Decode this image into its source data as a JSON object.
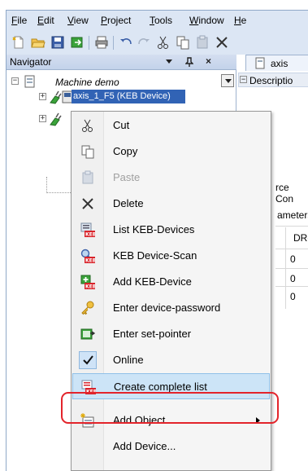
{
  "menubar": {
    "items": [
      {
        "label": "File",
        "mnemonic": "F",
        "rest": "ile"
      },
      {
        "label": "Edit",
        "mnemonic": "E",
        "rest": "dit"
      },
      {
        "label": "View",
        "mnemonic": "V",
        "rest": "iew"
      },
      {
        "label": "Project",
        "mnemonic": "P",
        "rest": "roject"
      },
      {
        "label": "Tools",
        "mnemonic": "T",
        "rest": "ools"
      },
      {
        "label": "Window",
        "mnemonic": "W",
        "rest": "indow"
      },
      {
        "label": "He",
        "mnemonic": "H",
        "rest": "e"
      }
    ]
  },
  "toolbar": {
    "icons": [
      "new-file-icon",
      "open-folder-icon",
      "save-icon",
      "export-icon",
      "print-icon",
      "undo-icon",
      "redo-icon",
      "cut-icon",
      "copy-icon",
      "paste-icon",
      "delete-icon"
    ]
  },
  "navigator": {
    "title": "Navigator",
    "pin_glyph": "▾ ⊥",
    "close_glyph": "×",
    "root_label": "Machine demo",
    "selected_child_label": "axis_1_F5 (KEB Device)"
  },
  "editor": {
    "tab_label": "axis",
    "description_label": "Descriptio",
    "fragments": {
      "source": "rce Con",
      "parameters": "ameters",
      "column": "DRe",
      "values": [
        "0",
        "0",
        "0"
      ]
    }
  },
  "context_menu": {
    "items": [
      {
        "label": "Cut",
        "icon": "cut-icon",
        "disabled": false
      },
      {
        "label": "Copy",
        "icon": "copy-icon",
        "disabled": false
      },
      {
        "label": "Paste",
        "icon": "paste-icon",
        "disabled": true
      },
      {
        "label": "Delete",
        "icon": "delete-icon",
        "disabled": false
      },
      {
        "label": "List KEB-Devices",
        "icon": "keb-list-icon",
        "disabled": false
      },
      {
        "label": "KEB Device-Scan",
        "icon": "keb-scan-icon",
        "disabled": false
      },
      {
        "label": "Add KEB-Device",
        "icon": "keb-add-icon",
        "disabled": false
      },
      {
        "label": "Enter device-password",
        "icon": "key-icon",
        "disabled": false
      },
      {
        "label": "Enter set-pointer",
        "icon": "set-pointer-icon",
        "disabled": false
      },
      {
        "label": "Online",
        "icon": "checkmark-icon",
        "checked": true
      },
      {
        "label": "Create complete list",
        "icon": "keb-complete-list-icon",
        "highlighted": true
      },
      {
        "label": "Add Object",
        "icon": "add-object-icon",
        "submenu": true
      },
      {
        "label": "Add Device...",
        "icon": "",
        "disabled": false
      }
    ]
  },
  "colors": {
    "window_bg": "#dce6f4",
    "highlight": "#cce4f7",
    "callout": "#e3242b",
    "keb_red": "#d9232a",
    "device_green": "#3aa33a"
  }
}
